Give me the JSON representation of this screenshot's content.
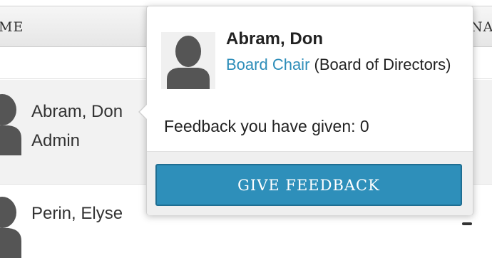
{
  "table": {
    "header_left": "ME",
    "header_right": "NA"
  },
  "rows": [
    {
      "name": "Abram, Don",
      "role": "Admin"
    },
    {
      "name": "Perin, Elyse"
    }
  ],
  "popover": {
    "name": "Abram, Don",
    "role_link": "Board Chair",
    "org": "(Board of Directors)",
    "feedback_text": "Feedback you have given: 0",
    "button_label": "GIVE FEEDBACK"
  },
  "icons": {
    "avatar": "person-silhouette-icon"
  },
  "colors": {
    "accent": "#2e8fba",
    "link": "#2d8db9",
    "avatar_fill": "#555555",
    "row_highlight": "#f2f2f2"
  }
}
